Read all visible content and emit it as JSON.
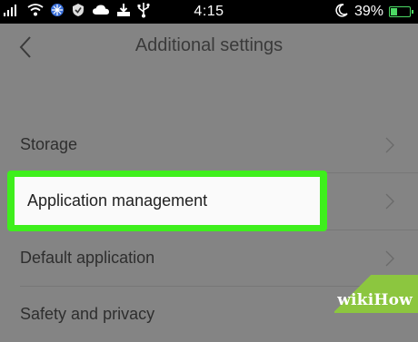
{
  "status_bar": {
    "time": "4:15",
    "battery_percent": "39%",
    "battery_level": 0.39,
    "icons": [
      "signal-icon",
      "wifi-icon",
      "snowflake-icon",
      "antivirus-icon",
      "cloud-icon",
      "download-icon",
      "usb-icon",
      "moon-icon",
      "battery-charging-icon"
    ]
  },
  "header": {
    "title": "Additional settings",
    "back_icon": "chevron-left-icon"
  },
  "settings": {
    "items": [
      {
        "label": "Storage"
      },
      {
        "label": "Application management"
      },
      {
        "label": "Default application"
      },
      {
        "label": "Safety and privacy"
      }
    ]
  },
  "colors": {
    "highlight": "#3eef1c",
    "background": "#848484"
  },
  "watermark": {
    "text_wiki": "wiki",
    "text_how": "How"
  }
}
